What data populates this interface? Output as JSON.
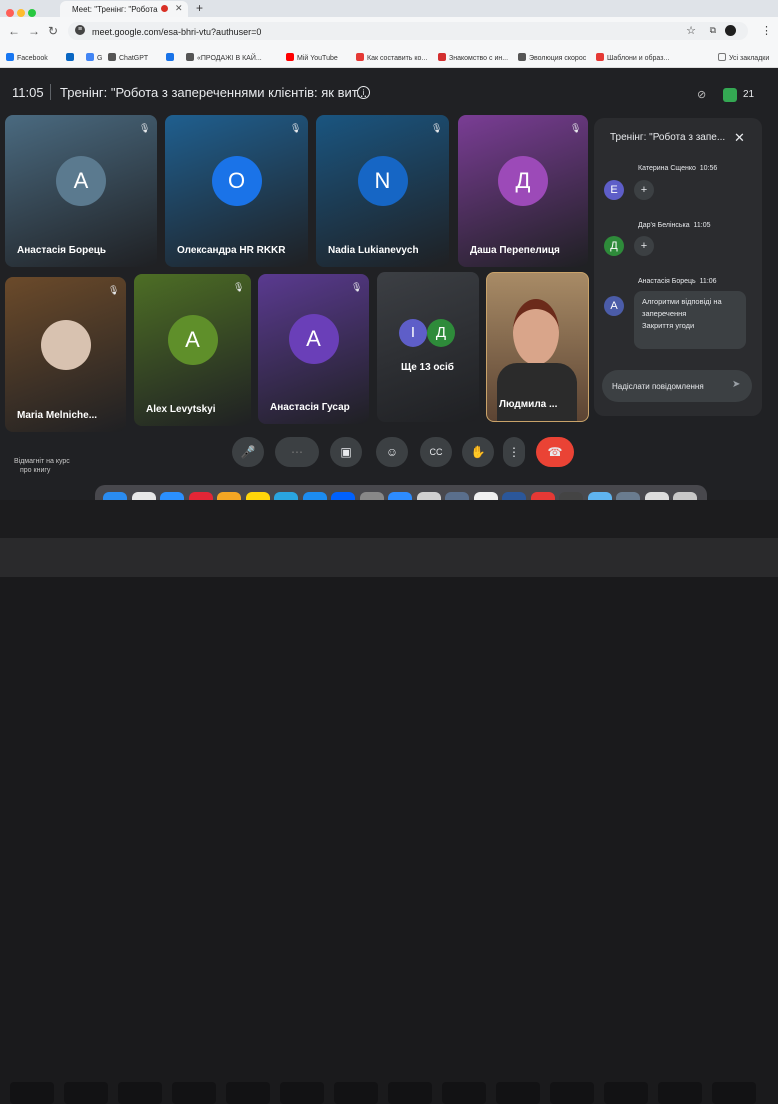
{
  "browser": {
    "tab_title": "Meet: \"Тренінг: \"Робота",
    "url": "meet.google.com/esa-bhri-vtu?authuser=0",
    "bookmarks": [
      {
        "label": "Facebook",
        "color": "#1877f2"
      },
      {
        "label": "",
        "color": "#0a66c2"
      },
      {
        "label": "G",
        "color": "#4285f4"
      },
      {
        "label": "ChatGPT",
        "color": "#555555"
      },
      {
        "label": "",
        "color": "#1a73e8"
      },
      {
        "label": "«ПРОДАЖІ В КАЙ...",
        "color": "#555555"
      },
      {
        "label": "Мій YouTube",
        "color": "#ff0000"
      },
      {
        "label": "Как составить ко...",
        "color": "#e53935"
      },
      {
        "label": "Знакомство с ин...",
        "color": "#d32f2f"
      },
      {
        "label": "Эволюция скорос",
        "color": "#555555"
      },
      {
        "label": "Шаблони и образ...",
        "color": "#e53935"
      }
    ],
    "bookmarks_right": "Усі закладки"
  },
  "meeting": {
    "time": "11:05",
    "title": "Тренінг: \"Робота з запереченнями клієнтів: як вит...",
    "participant_count": "21"
  },
  "tiles": [
    {
      "name": "Анастасія Борець",
      "initial": "А",
      "bg": "#4a6a80",
      "avatar": "#5b7a8f"
    },
    {
      "name": "Олександра HR RKKR",
      "initial": "О",
      "bg": "#1f5f8f",
      "avatar": "#1a73e8"
    },
    {
      "name": "Nadia Lukianevych",
      "initial": "N",
      "bg": "#1a5580",
      "avatar": "#1666c5"
    },
    {
      "name": "Даша Перепелиця",
      "initial": "Д",
      "bg": "#7a3d95",
      "avatar": "#9c4ab8"
    },
    {
      "name": "Maria Melniche...",
      "initial": "",
      "bg": "#6b4a2a",
      "avatar": "#d8c2b0"
    },
    {
      "name": "Alex Levytskyi",
      "initial": "A",
      "bg": "#4d6e25",
      "avatar": "#5f8f2a"
    },
    {
      "name": "Анастасія Гусар",
      "initial": "А",
      "bg": "#5a3a90",
      "avatar": "#6a3fb8"
    },
    {
      "name": "Ще 13 осіб",
      "initial": "",
      "bg": "#3c3f44",
      "avatar": ""
    },
    {
      "name": "Людмила ...",
      "initial": "",
      "bg": "#8a6a4a",
      "avatar": ""
    }
  ],
  "more_avatars": [
    {
      "initial": "І",
      "color": "#5e5ec8"
    },
    {
      "initial": "Д",
      "color": "#2e8b3a"
    }
  ],
  "chat": {
    "title": "Тренінг: \"Робота з запе...",
    "messages": [
      {
        "author": "Катерина Сщенко",
        "time": "10:56",
        "initial": "Е",
        "color": "#5e5ec8"
      },
      {
        "author": "Дар'я Белінська",
        "time": "11:05",
        "initial": "Д",
        "color": "#2e8b3a"
      },
      {
        "author": "Анастасія Борець",
        "time": "11:06",
        "initial": "А",
        "color": "#4b5ca8",
        "lines": [
          "Алгоритми відповіді на",
          "заперечення",
          "Закриття угоди"
        ]
      }
    ],
    "input_placeholder": "Надіслати повідомлення"
  },
  "caption": [
    "Відмагніт на курс",
    "про книгу"
  ],
  "dock_colors": [
    "#2a8cf0",
    "#e8e8e8",
    "#2b90ff",
    "#e32636",
    "#f5a623",
    "#ffd60a",
    "#2aa5e0",
    "#1c8cf0",
    "#0061fe",
    "#888888",
    "#2d8cff",
    "#d0d0d0",
    "#5a6f8c",
    "#f0f0f0",
    "#2b579a",
    "#e53935",
    "#444444",
    "#5fb4f0",
    "#6a7c8f",
    "#dddddd",
    "#c8c8c8"
  ]
}
